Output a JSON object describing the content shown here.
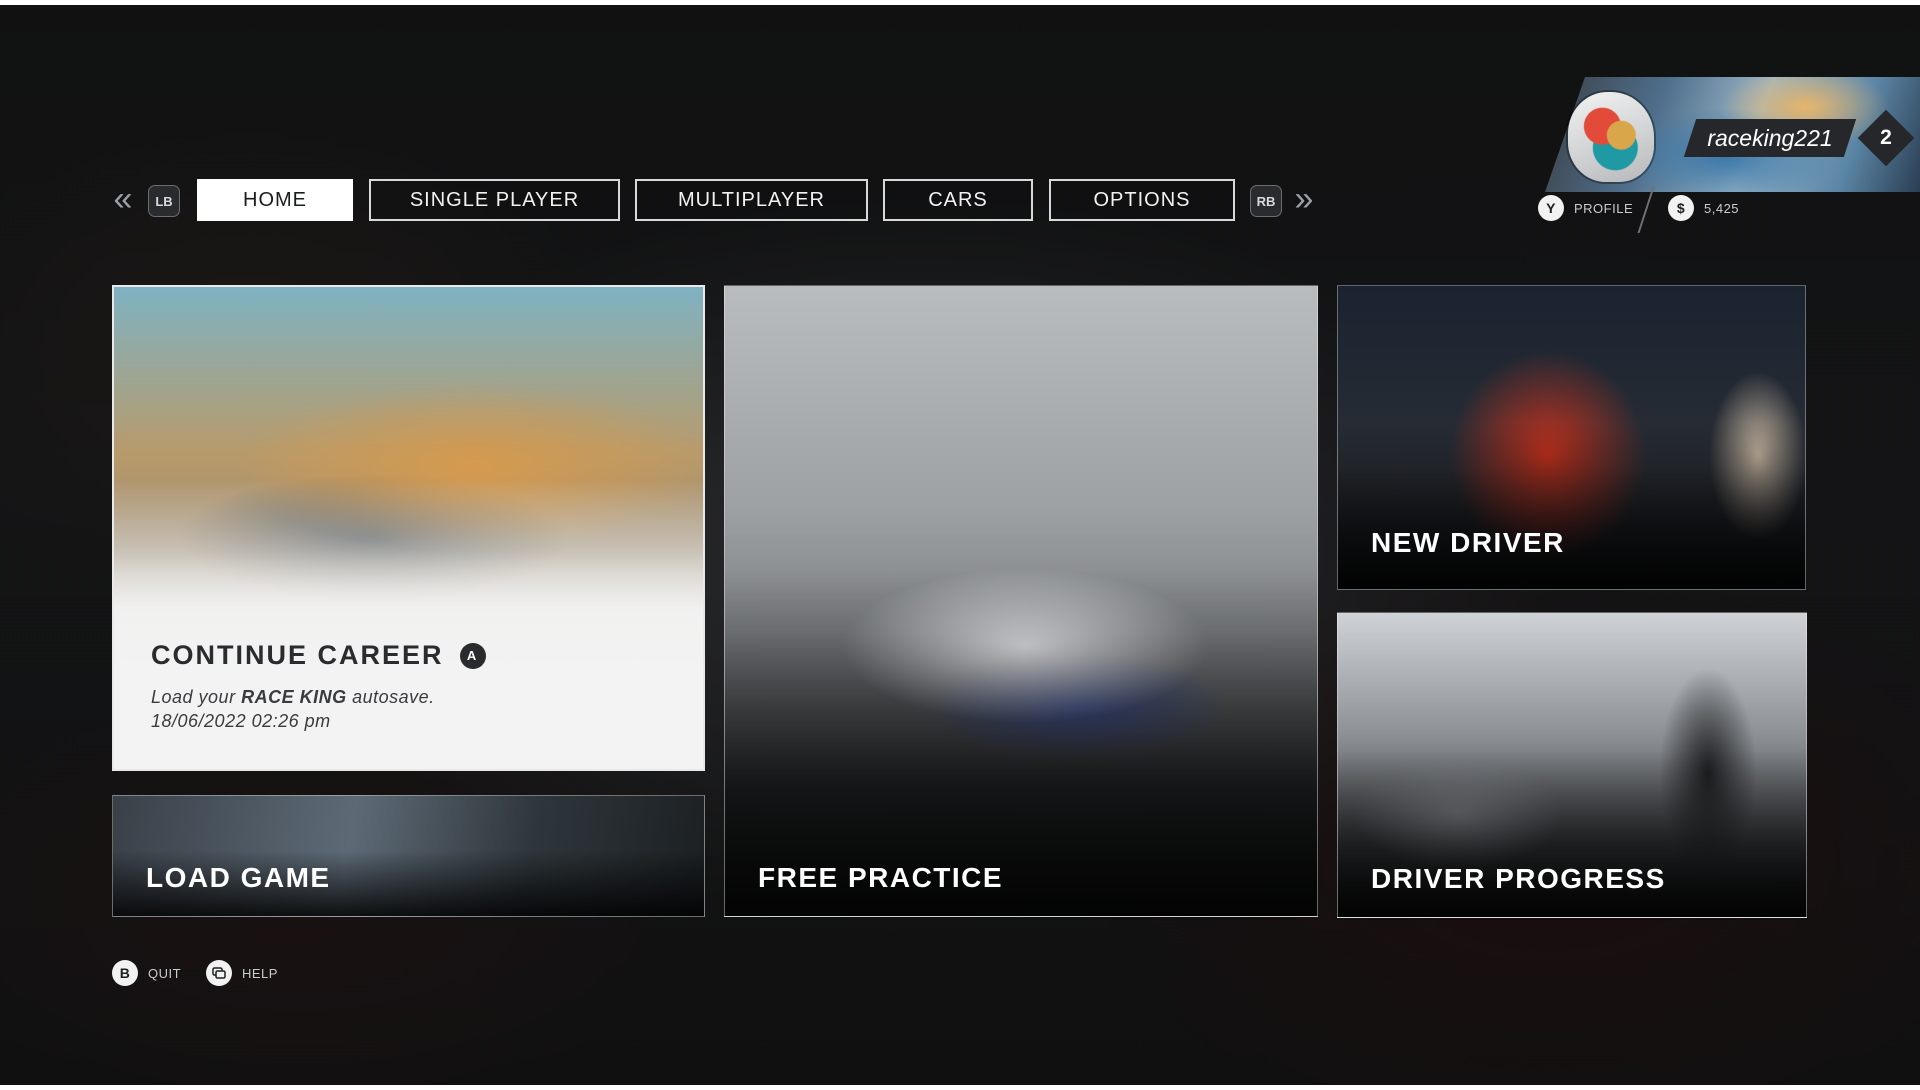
{
  "nav": {
    "left_bumper": "LB",
    "right_bumper": "RB",
    "tabs": [
      {
        "label": "HOME",
        "active": true
      },
      {
        "label": "SINGLE PLAYER",
        "active": false
      },
      {
        "label": "MULTIPLAYER",
        "active": false
      },
      {
        "label": "CARS",
        "active": false
      },
      {
        "label": "OPTIONS",
        "active": false
      }
    ]
  },
  "profile": {
    "username": "raceking221",
    "level": "2",
    "profile_button": "Y",
    "profile_label": "PROFILE",
    "currency_symbol": "$",
    "currency_amount": "5,425"
  },
  "tiles": {
    "continue_career": {
      "title": "CONTINUE CAREER",
      "button": "A",
      "sub_prefix": "Load your",
      "sub_bold": "RACE KING",
      "sub_suffix": "autosave.",
      "timestamp": "18/06/2022 02:26 pm"
    },
    "load_game": {
      "title": "LOAD GAME"
    },
    "free_practice": {
      "title": "FREE PRACTICE"
    },
    "new_driver": {
      "title": "NEW DRIVER"
    },
    "driver_progress": {
      "title": "DRIVER PROGRESS"
    }
  },
  "footer": {
    "quit_button": "B",
    "quit_label": "QUIT",
    "help_label": "HELP"
  },
  "colors": {
    "active_tab_bg": "#ffffff",
    "panel_dark": "#26272a",
    "career_panel": "#f3f3f3"
  }
}
